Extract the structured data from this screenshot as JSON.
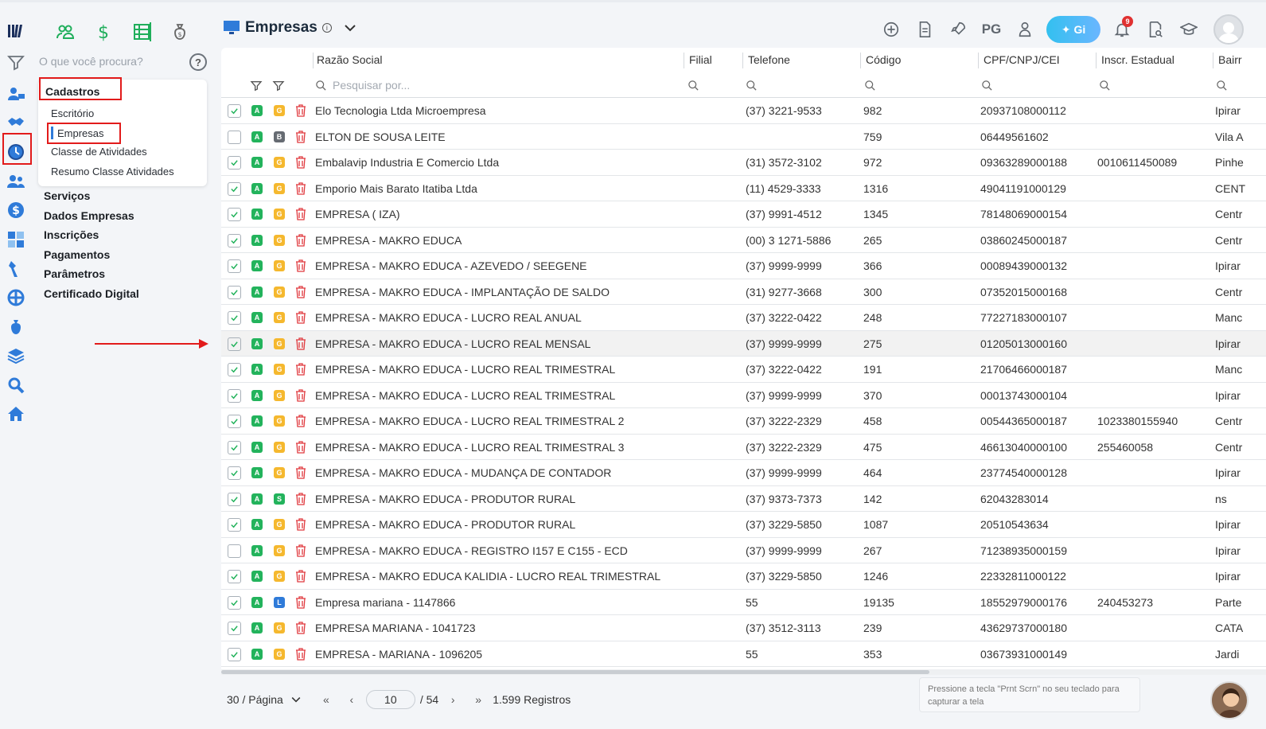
{
  "search": {
    "placeholder": "O que você procura?"
  },
  "sidebar": {
    "group_title": "Cadastros",
    "group_items": [
      {
        "label": "Escritório"
      },
      {
        "label": "Empresas"
      },
      {
        "label": "Classe de Atividades"
      },
      {
        "label": "Resumo Classe Atividades"
      }
    ],
    "sections": [
      {
        "label": "Serviços"
      },
      {
        "label": "Dados Empresas"
      },
      {
        "label": "Inscrições"
      },
      {
        "label": "Pagamentos"
      },
      {
        "label": "Parâmetros"
      },
      {
        "label": "Certificado Digital"
      }
    ]
  },
  "header": {
    "title": "Empresas",
    "pg_label": "PG",
    "gi_label": "Gi",
    "notification_count": "9"
  },
  "table": {
    "columns": [
      {
        "label": "Razão Social"
      },
      {
        "label": "Filial"
      },
      {
        "label": "Telefone"
      },
      {
        "label": "Código"
      },
      {
        "label": "CPF/CNPJ/CEI"
      },
      {
        "label": "Inscr. Estadual"
      },
      {
        "label": "Bairr"
      }
    ],
    "search_placeholder": "Pesquisar por...",
    "rows": [
      {
        "checked": true,
        "tag2": "G",
        "razao": "Elo Tecnologia Ltda Microempresa",
        "telefone": "(37) 3221-9533",
        "codigo": "982",
        "cnpj": "20937108000112",
        "ie": "",
        "bairro": "Ipirar"
      },
      {
        "checked": false,
        "tag2": "B",
        "razao": "ELTON DE SOUSA LEITE",
        "telefone": "",
        "codigo": "759",
        "cnpj": "06449561602",
        "ie": "",
        "bairro": "Vila A"
      },
      {
        "checked": true,
        "tag2": "G",
        "razao": "Embalavip Industria E Comercio Ltda",
        "telefone": "(31) 3572-3102",
        "codigo": "972",
        "cnpj": "09363289000188",
        "ie": "0010611450089",
        "bairro": "Pinhe"
      },
      {
        "checked": true,
        "tag2": "G",
        "razao": "Emporio Mais Barato Itatiba Ltda",
        "telefone": "(11) 4529-3333",
        "codigo": "1316",
        "cnpj": "49041191000129",
        "ie": "",
        "bairro": "CENT"
      },
      {
        "checked": true,
        "tag2": "G",
        "razao": "EMPRESA ( IZA)",
        "telefone": "(37) 9991-4512",
        "codigo": "1345",
        "cnpj": "78148069000154",
        "ie": "",
        "bairro": "Centr"
      },
      {
        "checked": true,
        "tag2": "G",
        "razao": "EMPRESA - MAKRO EDUCA",
        "telefone": "(00) 3 1271-5886",
        "codigo": "265",
        "cnpj": "03860245000187",
        "ie": "",
        "bairro": "Centr"
      },
      {
        "checked": true,
        "tag2": "G",
        "razao": "EMPRESA - MAKRO EDUCA - AZEVEDO / SEEGENE",
        "telefone": "(37) 9999-9999",
        "codigo": "366",
        "cnpj": "00089439000132",
        "ie": "",
        "bairro": "Ipirar"
      },
      {
        "checked": true,
        "tag2": "G",
        "razao": "EMPRESA - MAKRO EDUCA - IMPLANTAÇÃO DE SALDO",
        "telefone": "(31) 9277-3668",
        "codigo": "300",
        "cnpj": "07352015000168",
        "ie": "",
        "bairro": "Centr"
      },
      {
        "checked": true,
        "tag2": "G",
        "razao": "EMPRESA - MAKRO EDUCA - LUCRO REAL ANUAL",
        "telefone": "(37) 3222-0422",
        "codigo": "248",
        "cnpj": "77227183000107",
        "ie": "",
        "bairro": "Manc"
      },
      {
        "checked": true,
        "tag2": "G",
        "razao": "EMPRESA - MAKRO EDUCA - LUCRO REAL MENSAL",
        "telefone": "(37) 9999-9999",
        "codigo": "275",
        "cnpj": "01205013000160",
        "ie": "",
        "bairro": "Ipirar",
        "highlight": true
      },
      {
        "checked": true,
        "tag2": "G",
        "razao": "EMPRESA - MAKRO EDUCA - LUCRO REAL TRIMESTRAL",
        "telefone": "(37) 3222-0422",
        "codigo": "191",
        "cnpj": "21706466000187",
        "ie": "",
        "bairro": "Manc"
      },
      {
        "checked": true,
        "tag2": "G",
        "razao": "EMPRESA - MAKRO EDUCA - LUCRO REAL TRIMESTRAL",
        "telefone": "(37) 9999-9999",
        "codigo": "370",
        "cnpj": "00013743000104",
        "ie": "",
        "bairro": "Ipirar"
      },
      {
        "checked": true,
        "tag2": "G",
        "razao": "EMPRESA - MAKRO EDUCA - LUCRO REAL TRIMESTRAL 2",
        "telefone": "(37) 3222-2329",
        "codigo": "458",
        "cnpj": "00544365000187",
        "ie": "1023380155940",
        "bairro": "Centr"
      },
      {
        "checked": true,
        "tag2": "G",
        "razao": "EMPRESA - MAKRO EDUCA - LUCRO REAL TRIMESTRAL 3",
        "telefone": "(37) 3222-2329",
        "codigo": "475",
        "cnpj": "46613040000100",
        "ie": "255460058",
        "bairro": "Centr"
      },
      {
        "checked": true,
        "tag2": "G",
        "razao": "EMPRESA - MAKRO EDUCA - MUDANÇA DE CONTADOR",
        "telefone": "(37) 9999-9999",
        "codigo": "464",
        "cnpj": "23774540000128",
        "ie": "",
        "bairro": "Ipirar"
      },
      {
        "checked": true,
        "tag2": "S",
        "razao": "EMPRESA - MAKRO EDUCA - PRODUTOR RURAL",
        "telefone": "(37) 9373-7373",
        "codigo": "142",
        "cnpj": "62043283014",
        "ie": "",
        "bairro": "ns"
      },
      {
        "checked": true,
        "tag2": "G",
        "razao": "EMPRESA - MAKRO EDUCA - PRODUTOR RURAL",
        "telefone": "(37) 3229-5850",
        "codigo": "1087",
        "cnpj": "20510543634",
        "ie": "",
        "bairro": "Ipirar"
      },
      {
        "checked": false,
        "tag2": "G",
        "razao": "EMPRESA - MAKRO EDUCA - REGISTRO I157 E C155 - ECD",
        "telefone": "(37) 9999-9999",
        "codigo": "267",
        "cnpj": "71238935000159",
        "ie": "",
        "bairro": "Ipirar"
      },
      {
        "checked": true,
        "tag2": "G",
        "razao": "EMPRESA - MAKRO EDUCA KALIDIA - LUCRO REAL TRIMESTRAL",
        "telefone": "(37) 3229-5850",
        "codigo": "1246",
        "cnpj": "22332811000122",
        "ie": "",
        "bairro": "Ipirar"
      },
      {
        "checked": true,
        "tag2": "L",
        "razao": "Empresa mariana - 1147866",
        "telefone": "55",
        "codigo": "19135",
        "cnpj": "18552979000176",
        "ie": "240453273",
        "bairro": "Parte"
      },
      {
        "checked": true,
        "tag2": "G",
        "razao": "EMPRESA MARIANA - 1041723",
        "telefone": "(37) 3512-3113",
        "codigo": "239",
        "cnpj": "43629737000180",
        "ie": "",
        "bairro": "CATA"
      },
      {
        "checked": true,
        "tag2": "G",
        "razao": "EMPRESA - MARIANA - 1096205",
        "telefone": "55",
        "codigo": "353",
        "cnpj": "03673931000149",
        "ie": "",
        "bairro": "Jardi"
      }
    ]
  },
  "pagination": {
    "per_page": "30 / Página",
    "current_page": "10",
    "total_pages": "/ 54",
    "total_records": "1.599 Registros"
  },
  "tooltip": {
    "text": "Pressione a tecla \"Prnt Scrn\" no seu teclado para capturar a tela"
  },
  "colors": {
    "accent": "#2f7bd9",
    "green_tag": "#23b35c",
    "orange_tag": "#f5b82e",
    "red_highlight": "#e21b1b",
    "brand_icon": "#1f4f9a"
  }
}
